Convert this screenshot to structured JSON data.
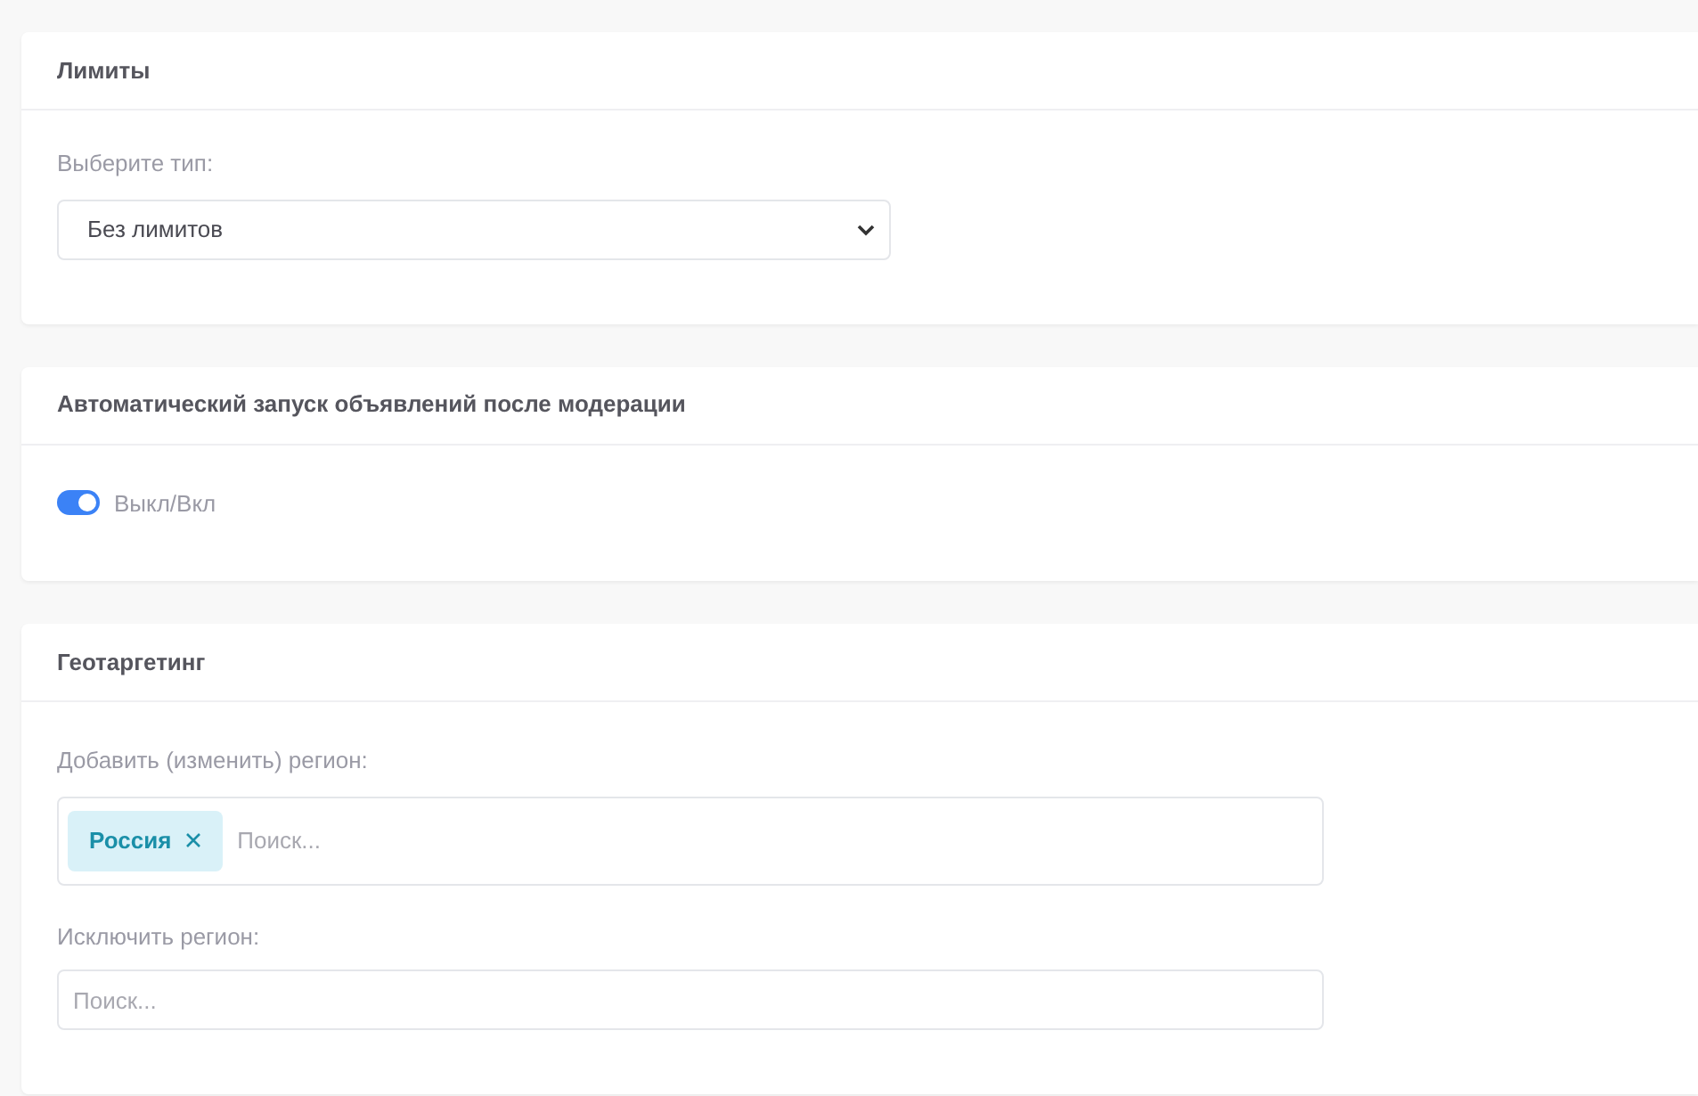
{
  "sections": [
    {
      "kind": "select",
      "title": "Лимиты",
      "label": "Выберите тип:",
      "value": "Без лимитов"
    },
    {
      "kind": "toggle",
      "title": "Автоматический запуск объявлений после модерации",
      "label": "Выкл/Вкл",
      "on": true
    },
    {
      "kind": "regions",
      "title": "Геотаргетинг",
      "include": {
        "label": "Добавить (изменить) регион:",
        "tags": [
          "Россия"
        ],
        "placeholder": "Поиск..."
      },
      "exclude": {
        "label": "Исключить регион:",
        "placeholder": "Поиск..."
      }
    }
  ]
}
